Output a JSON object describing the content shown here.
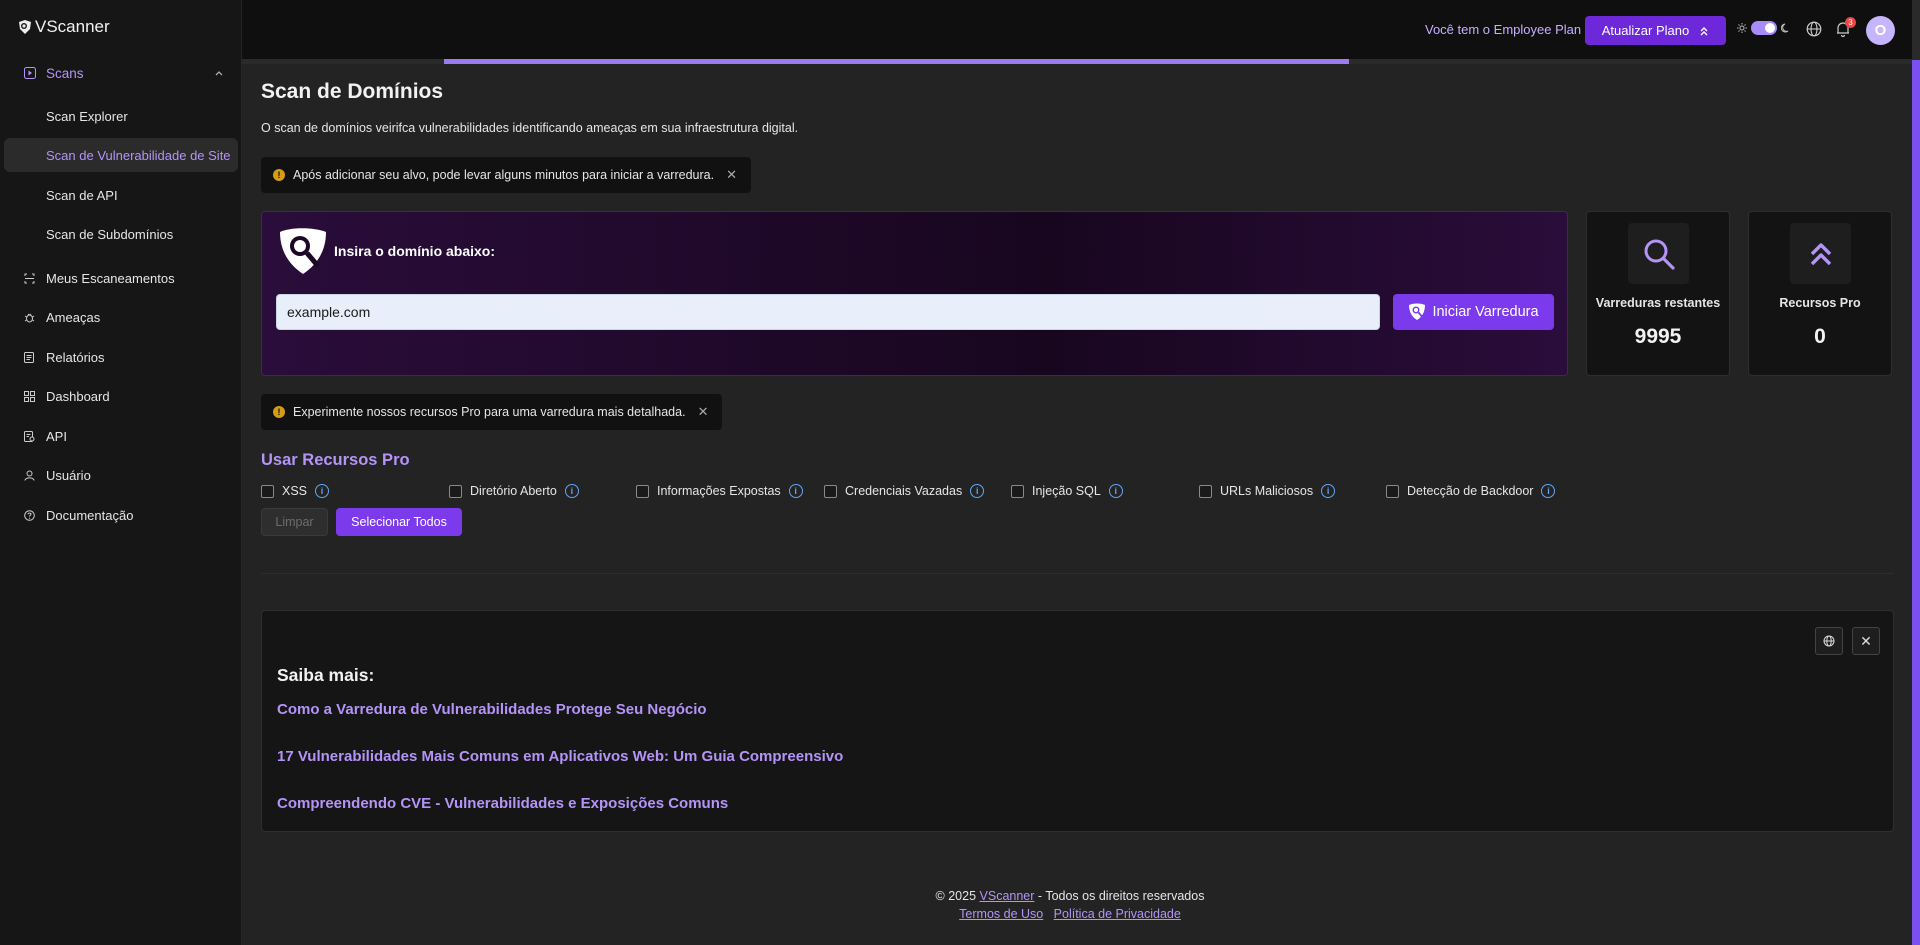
{
  "app": {
    "name": "VScanner"
  },
  "sidebar": {
    "group": {
      "label": "Scans",
      "icon": "play-square-icon",
      "expanded": true
    },
    "sub_items": [
      {
        "label": "Scan Explorer",
        "active": false
      },
      {
        "label": "Scan de Vulnerabilidade de Site",
        "active": true
      },
      {
        "label": "Scan de API",
        "active": false
      },
      {
        "label": "Scan de Subdomínios",
        "active": false
      }
    ],
    "items": [
      {
        "label": "Meus Escaneamentos",
        "icon": "scan-frame-icon"
      },
      {
        "label": "Ameaças",
        "icon": "bug-icon"
      },
      {
        "label": "Relatórios",
        "icon": "report-icon"
      },
      {
        "label": "Dashboard",
        "icon": "grid-icon"
      },
      {
        "label": "API",
        "icon": "api-doc-icon"
      },
      {
        "label": "Usuário",
        "icon": "user-icon"
      },
      {
        "label": "Documentação",
        "icon": "help-circle-icon"
      }
    ]
  },
  "topbar": {
    "plan_text": "Você tem o Employee Plan",
    "upgrade_label": "Atualizar Plano",
    "notification_count": "3",
    "avatar_initial": "O",
    "progress": 0.5
  },
  "main": {
    "title": "Scan de Domínios",
    "description": "O scan de domínios veirifca vulnerabilidades identificando ameaças em sua infraestrutura digital.",
    "alert1": "Após adicionar seu alvo, pode levar alguns minutos para iniciar a varredura.",
    "alert2": "Experimente nossos recursos Pro para uma varredura mais detalhada.",
    "scan_panel": {
      "label": "Insira o domínio abaixo:",
      "input_value": "example.com",
      "button_label": "Iniciar Varredura"
    },
    "stats": [
      {
        "label": "Varreduras restantes",
        "value": "9995",
        "icon": "search-icon"
      },
      {
        "label": "Recursos Pro",
        "value": "0",
        "icon": "double-chevron-up-icon"
      }
    ],
    "pro": {
      "title": "Usar Recursos Pro",
      "options": [
        "XSS",
        "Diretório Aberto",
        "Informações Expostas",
        "Credenciais Vazadas",
        "Injeção SQL",
        "URLs Maliciosos",
        "Detecção de Backdoor"
      ],
      "clear_label": "Limpar",
      "select_all_label": "Selecionar Todos"
    },
    "learn_more": {
      "title": "Saiba mais:",
      "links": [
        "Como a Varredura de Vulnerabilidades Protege Seu Negócio",
        "17 Vulnerabilidades Mais Comuns em Aplicativos Web: Um Guia Compreensivo",
        "Compreendendo CVE - Vulnerabilidades e Exposições Comuns"
      ]
    }
  },
  "footer": {
    "copyright_prefix": "© 2025",
    "brand": "VScanner",
    "rights": "- Todos os direitos reservados",
    "terms": "Termos de Uso",
    "privacy": "Política de Privacidade"
  },
  "colors": {
    "accent": "#7c3aed",
    "accent_light": "#b494f7",
    "background": "#232323",
    "sidebar": "#161616"
  }
}
